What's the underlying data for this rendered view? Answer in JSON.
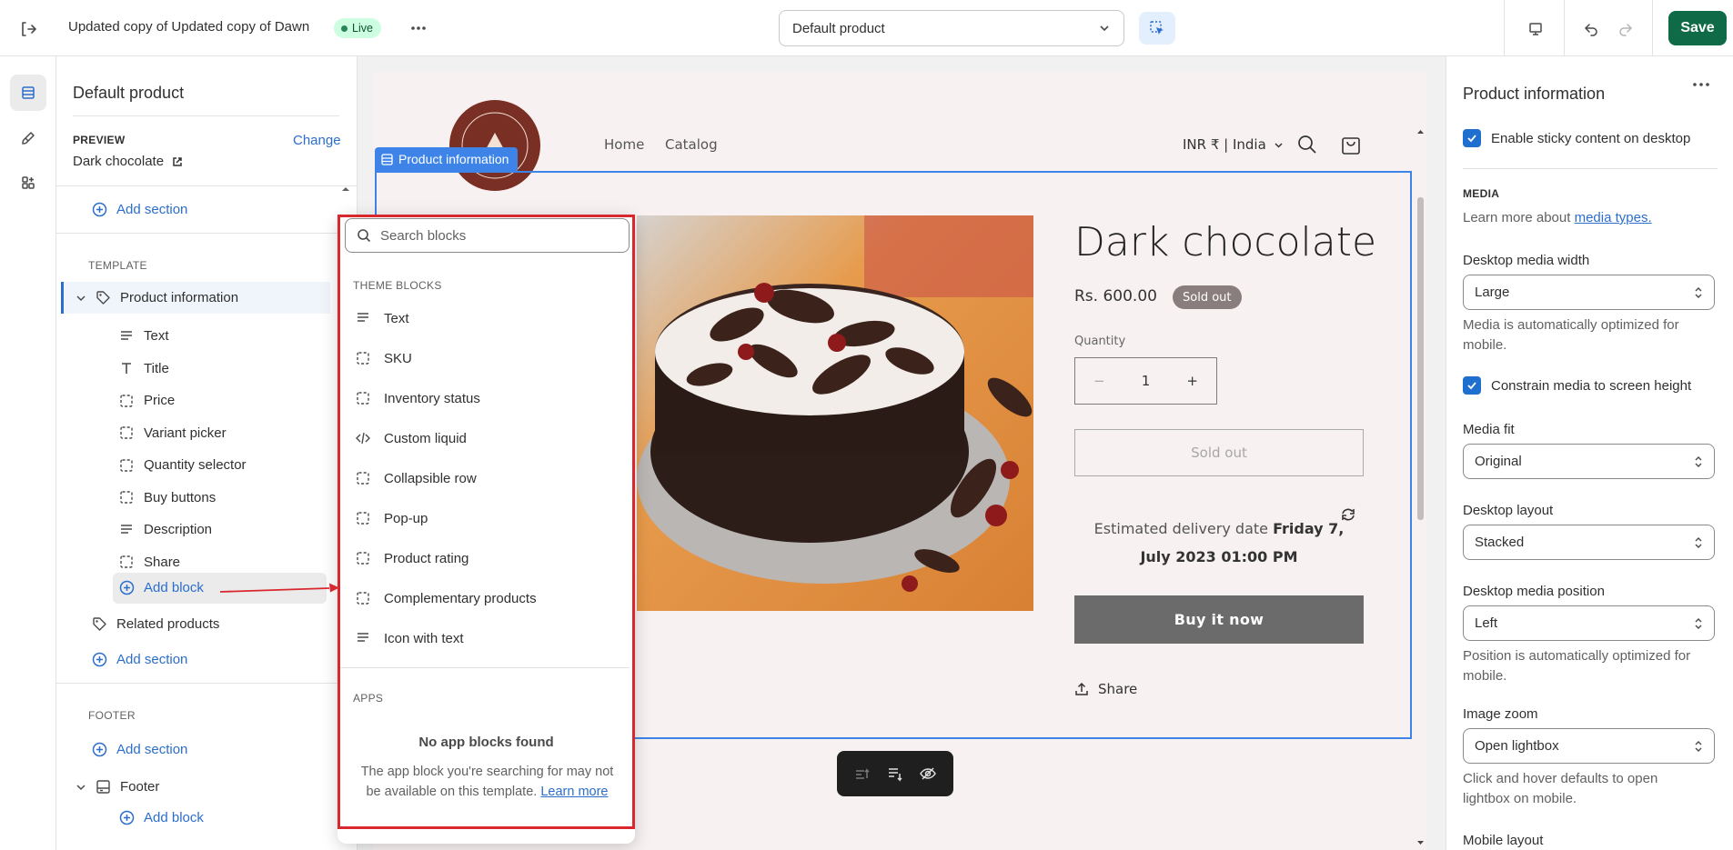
{
  "topbar": {
    "store_name": "Updated copy of Updated copy of Dawn",
    "live_badge": "Live",
    "template_select": "Default product",
    "save_label": "Save"
  },
  "sidebar": {
    "title": "Default product",
    "preview_label": "PREVIEW",
    "change_label": "Change",
    "preview_value": "Dark chocolate",
    "add_section_1": "Add section",
    "template_heading": "TEMPLATE",
    "product_information": "Product information",
    "blocks": [
      "Text",
      "Title",
      "Price",
      "Variant picker",
      "Quantity selector",
      "Buy buttons",
      "Description",
      "Share"
    ],
    "add_block": "Add block",
    "related_products": "Related products",
    "add_section_2": "Add section",
    "footer_heading": "FOOTER",
    "add_section_3": "Add section",
    "footer": "Footer",
    "add_block_footer": "Add block"
  },
  "popover": {
    "search_placeholder": "Search blocks",
    "theme_heading": "THEME BLOCKS",
    "items": [
      {
        "label": "Text",
        "icon": "text-icon"
      },
      {
        "label": "SKU",
        "icon": "block-icon"
      },
      {
        "label": "Inventory status",
        "icon": "block-icon"
      },
      {
        "label": "Custom liquid",
        "icon": "code-icon"
      },
      {
        "label": "Collapsible row",
        "icon": "block-icon"
      },
      {
        "label": "Pop-up",
        "icon": "block-icon"
      },
      {
        "label": "Product rating",
        "icon": "block-icon"
      },
      {
        "label": "Complementary products",
        "icon": "block-icon"
      },
      {
        "label": "Icon with text",
        "icon": "text-icon"
      }
    ],
    "apps_heading": "APPS",
    "no_apps_title": "No app blocks found",
    "no_apps_desc": "The app block you're searching for may not be available on this template.",
    "learn_more": "Learn more"
  },
  "canvas": {
    "section_tag": "Product information",
    "nav_home": "Home",
    "nav_catalog": "Catalog",
    "currency": "INR ₹ | India",
    "product_title": "Dark chocolate",
    "price": "Rs. 600.00",
    "sold_out_badge": "Sold out",
    "quantity_label": "Quantity",
    "quantity_value": "1",
    "sold_out_button": "Sold out",
    "delivery_prefix": "Estimated delivery date",
    "delivery_date": "Friday 7, July 2023 01:00 PM",
    "buy_now": "Buy it now",
    "share": "Share"
  },
  "settings": {
    "title": "Product information",
    "sticky_label": "Enable sticky content on desktop",
    "media_heading": "MEDIA",
    "media_help": "Learn more about",
    "media_link": "media types.",
    "desktop_width_label": "Desktop media width",
    "desktop_width_value": "Large",
    "desktop_width_help": "Media is automatically optimized for mobile.",
    "constrain_label": "Constrain media to screen height",
    "media_fit_label": "Media fit",
    "media_fit_value": "Original",
    "desktop_layout_label": "Desktop layout",
    "desktop_layout_value": "Stacked",
    "media_position_label": "Desktop media position",
    "media_position_value": "Left",
    "media_position_help": "Position is automatically optimized for mobile.",
    "image_zoom_label": "Image zoom",
    "image_zoom_value": "Open lightbox",
    "image_zoom_help": "Click and hover defaults to open lightbox on mobile.",
    "mobile_layout_label": "Mobile layout"
  },
  "colors": {
    "accent": "#2c6ecb",
    "save": "#0f6b47",
    "highlight": "#d9272e",
    "selection": "#3d83e8"
  }
}
